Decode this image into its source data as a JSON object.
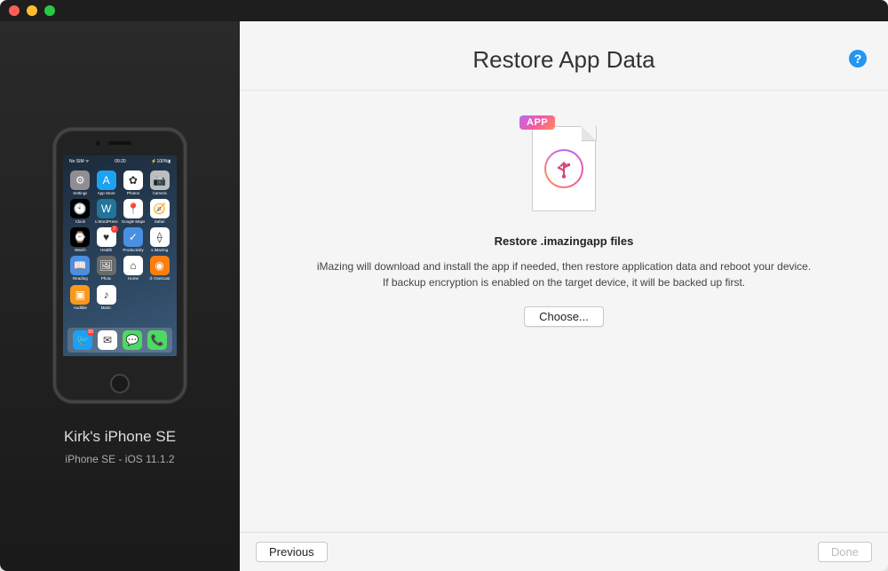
{
  "sidebar": {
    "device_name": "Kirk's iPhone SE",
    "device_subtitle": "iPhone SE - iOS 11.1.2",
    "status_bar": {
      "left": "No SIM ᯤ",
      "center": "09:20",
      "right": "⚡100%▮"
    },
    "apps": [
      {
        "label": "Settings",
        "bg": "#8e8e93",
        "glyph": "⚙"
      },
      {
        "label": "App Store",
        "bg": "#1da1f2",
        "glyph": "A"
      },
      {
        "label": "Photos",
        "bg": "#ffffff",
        "glyph": "✿"
      },
      {
        "label": "Camera",
        "bg": "#bdbdbd",
        "glyph": "📷"
      },
      {
        "label": "Clock",
        "bg": "#000000",
        "glyph": "🕙"
      },
      {
        "label": "1.WordPress",
        "bg": "#21759b",
        "glyph": "W"
      },
      {
        "label": "Google Maps",
        "bg": "#ffffff",
        "glyph": "📍"
      },
      {
        "label": "Safari",
        "bg": "#ffffff",
        "glyph": "🧭"
      },
      {
        "label": "Watch",
        "bg": "#000000",
        "glyph": "⌚"
      },
      {
        "label": "Health",
        "bg": "#ffffff",
        "glyph": "♥",
        "badge": "2"
      },
      {
        "label": "Productivity",
        "bg": "#4a90e2",
        "glyph": "✓"
      },
      {
        "label": "x.iMazing",
        "bg": "#ffffff",
        "glyph": "⟠"
      },
      {
        "label": "Reading",
        "bg": "#4a90e2",
        "glyph": "📖"
      },
      {
        "label": "Photo",
        "bg": "#6a6a6a",
        "glyph": "🖼"
      },
      {
        "label": "Home",
        "bg": "#ffffff",
        "glyph": "⌂"
      },
      {
        "label": "③ Overcast",
        "bg": "#fc7e0f",
        "glyph": "◉"
      },
      {
        "label": "Audible",
        "bg": "#f8991d",
        "glyph": "▣"
      },
      {
        "label": "Music",
        "bg": "#ffffff",
        "glyph": "♪"
      }
    ],
    "dock": [
      {
        "bg": "#1da1f2",
        "glyph": "🐦",
        "badge": "93"
      },
      {
        "bg": "#ffffff",
        "glyph": "✉"
      },
      {
        "bg": "#4cd964",
        "glyph": "💬"
      },
      {
        "bg": "#4cd964",
        "glyph": "📞"
      }
    ]
  },
  "main": {
    "title": "Restore App Data",
    "file_badge": "APP",
    "subtitle": "Restore .imazingapp files",
    "description_line1": "iMazing will download and install the app if needed, then restore application data and reboot your device.",
    "description_line2": "If backup encryption is enabled on the target device, it will be backed up first.",
    "choose_label": "Choose..."
  },
  "footer": {
    "previous_label": "Previous",
    "done_label": "Done"
  },
  "icons": {
    "help": "?"
  }
}
